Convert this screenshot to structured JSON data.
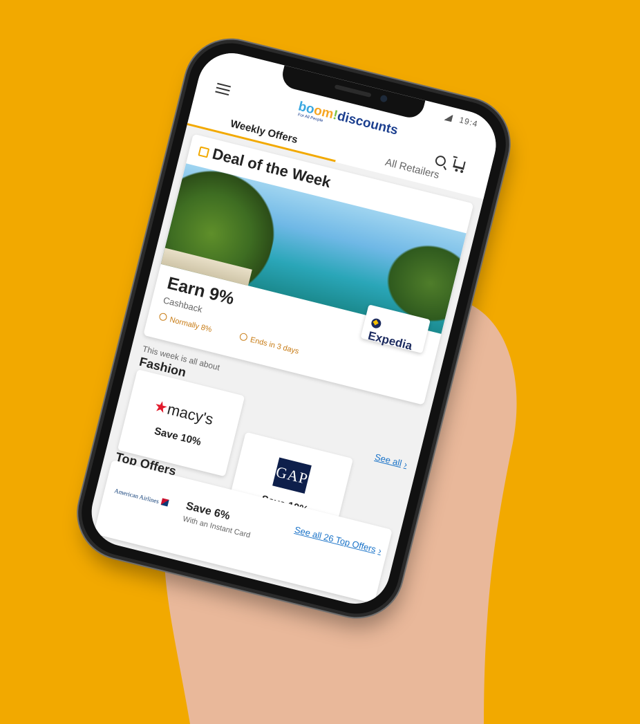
{
  "status": {
    "time": "19:4"
  },
  "header": {
    "logo_parts": [
      "bo",
      "om",
      "!",
      "discounts"
    ],
    "logo_tagline": "For All People",
    "tabs": [
      {
        "label": "Weekly Offers",
        "active": true
      },
      {
        "label": "All Retailers",
        "active": false
      }
    ]
  },
  "deal": {
    "title": "Deal of the Week",
    "earn": "Earn 9%",
    "cashback": "Cashback",
    "normally": "Normally 8%",
    "ends": "Ends in 3 days",
    "retailer": "Expedia"
  },
  "fashion": {
    "intro": "This week is all about",
    "title": "Fashion",
    "see_all": "See all",
    "brands": [
      {
        "name": "macy's",
        "save": "Save 10%"
      },
      {
        "name": "GAP",
        "save": "Save 10%"
      }
    ]
  },
  "top_offers": {
    "title": "Top Offers",
    "see_all": "See all 26 Top Offers",
    "items": [
      {
        "retailer": "American Airlines",
        "save": "Save 6%",
        "sub": "With an Instant Card"
      }
    ]
  },
  "colors": {
    "background": "#f2a900",
    "accent": "#f2a900",
    "link": "#1a73c8",
    "muted_orange": "#c77a12"
  }
}
